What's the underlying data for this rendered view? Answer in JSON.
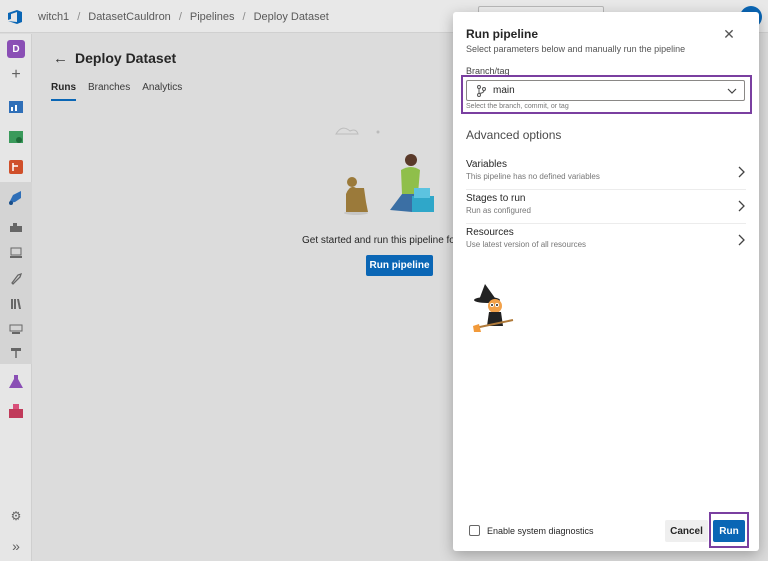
{
  "breadcrumbs": [
    "witch1",
    "DatasetCauldron",
    "Pipelines",
    "Deploy Dataset"
  ],
  "org_initial": "D",
  "page": {
    "title": "Deploy Dataset",
    "tabs": [
      "Runs",
      "Branches",
      "Analytics"
    ],
    "active_tab": "Runs",
    "get_started_text": "Get started and run this pipeline for th",
    "run_pipeline_label": "Run pipeline"
  },
  "panel": {
    "title": "Run pipeline",
    "subtitle": "Select parameters below and manually run the pipeline",
    "branch_label": "Branch/tag",
    "branch_value": "main",
    "branch_help": "Select the branch, commit, or tag",
    "advanced_title": "Advanced options",
    "options": [
      {
        "title": "Variables",
        "subtitle": "This pipeline has no defined variables"
      },
      {
        "title": "Stages to run",
        "subtitle": "Run as configured"
      },
      {
        "title": "Resources",
        "subtitle": "Use latest version of all resources"
      }
    ],
    "diagnostics_label": "Enable system diagnostics",
    "diagnostics_checked": false,
    "cancel_label": "Cancel",
    "run_label": "Run"
  },
  "icons": {
    "close": "close-icon",
    "branch": "branch-icon",
    "chevron_down": "chevron-down-icon",
    "chevron_right": "chevron-right-icon",
    "back": "back-arrow-icon"
  },
  "colors": {
    "primary": "#0a66b5",
    "highlight": "#7a3fa0"
  }
}
